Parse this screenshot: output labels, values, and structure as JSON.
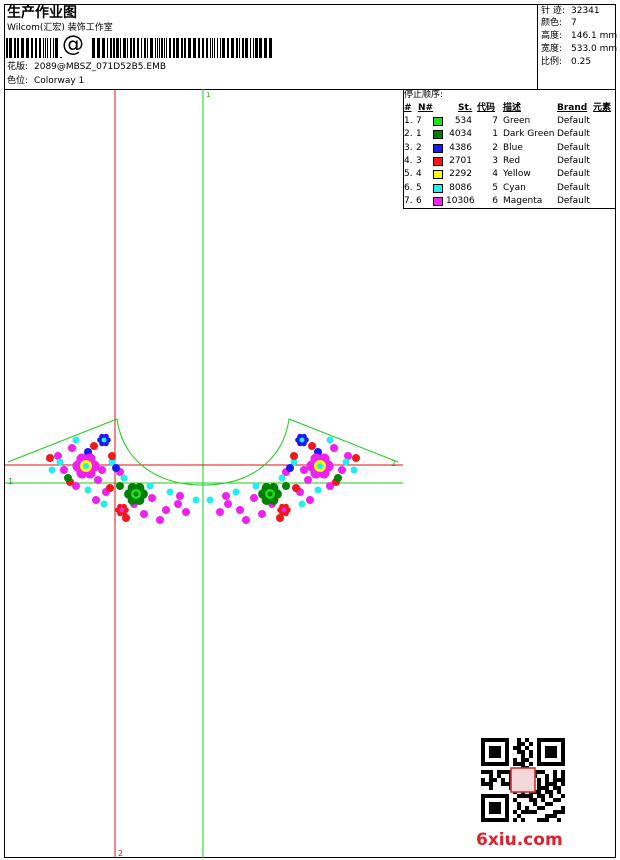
{
  "header": {
    "title": "生产作业图",
    "company": "Wilcom(汇宏) 装饰工作室",
    "barcode_symbol": "@",
    "design_label": "花版:",
    "design_value": "2089@MBSZ_071D52B5.EMB",
    "colorway_label": "色位:",
    "colorway_value": "Colorway 1"
  },
  "stats": [
    {
      "label": "针 迹:",
      "value": "32341"
    },
    {
      "label": "颜色:",
      "value": "7"
    },
    {
      "label": "高度:",
      "value": "146.1 mm"
    },
    {
      "label": "宽度:",
      "value": "533.0 mm"
    },
    {
      "label": "比例:",
      "value": "0.25"
    }
  ],
  "legend": {
    "title": "停止顺序:",
    "columns": [
      "#",
      "N#",
      "St.",
      "代码",
      "描述",
      "Brand",
      "元素"
    ],
    "rows": [
      {
        "idx": "1.",
        "n": "7",
        "color": "#22dd22",
        "st": "534",
        "code": "7",
        "desc": "Green",
        "brand": "Default"
      },
      {
        "idx": "2.",
        "n": "1",
        "color": "#008000",
        "st": "4034",
        "code": "1",
        "desc": "Dark Green",
        "brand": "Default"
      },
      {
        "idx": "3.",
        "n": "2",
        "color": "#1a1aee",
        "st": "4386",
        "code": "2",
        "desc": "Blue",
        "brand": "Default"
      },
      {
        "idx": "4.",
        "n": "3",
        "color": "#ee1a1a",
        "st": "2701",
        "code": "3",
        "desc": "Red",
        "brand": "Default"
      },
      {
        "idx": "5.",
        "n": "4",
        "color": "#ffff00",
        "st": "2292",
        "code": "4",
        "desc": "Yellow",
        "brand": "Default"
      },
      {
        "idx": "6.",
        "n": "5",
        "color": "#22eeee",
        "st": "8086",
        "code": "5",
        "desc": "Cyan",
        "brand": "Default"
      },
      {
        "idx": "7.",
        "n": "6",
        "color": "#ee22ee",
        "st": "10306",
        "code": "6",
        "desc": "Magenta",
        "brand": "Default"
      }
    ]
  },
  "canvas": {
    "axis_labels": [
      "1",
      "2",
      "1",
      "2"
    ],
    "guide_color": "#22cc22",
    "axis_color": "#dd1111"
  },
  "watermark": {
    "text": "6xiu.com"
  }
}
